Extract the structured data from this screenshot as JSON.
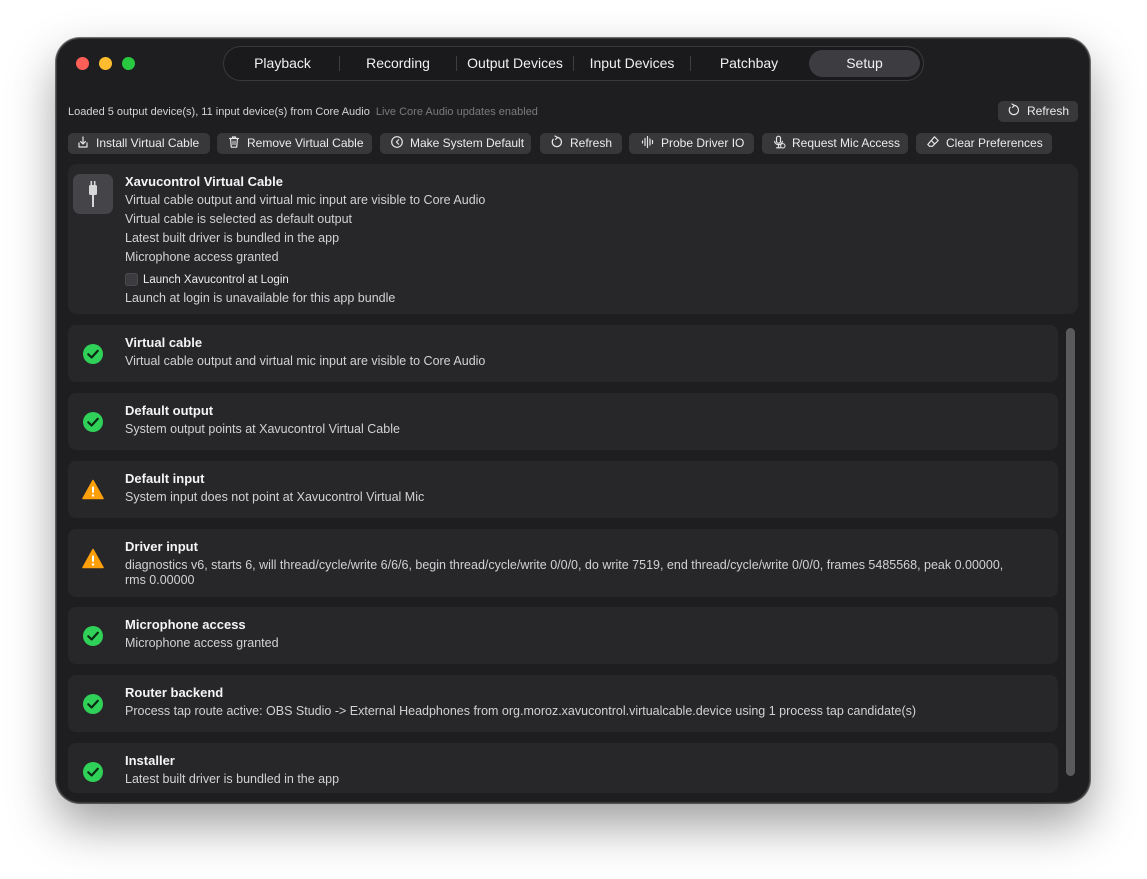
{
  "tabs": [
    {
      "label": "Playback"
    },
    {
      "label": "Recording"
    },
    {
      "label": "Output Devices"
    },
    {
      "label": "Input Devices"
    },
    {
      "label": "Patchbay"
    },
    {
      "label": "Setup",
      "active": true
    }
  ],
  "status": {
    "loaded": "Loaded 5 output device(s), 11 input device(s) from Core Audio",
    "live": "Live Core Audio updates enabled",
    "refresh_label": "Refresh"
  },
  "toolbar": {
    "install": "Install Virtual Cable",
    "remove": "Remove Virtual Cable",
    "make_default": "Make System Default",
    "refresh": "Refresh",
    "probe": "Probe Driver IO",
    "mic": "Request Mic Access",
    "clear": "Clear Preferences"
  },
  "info": {
    "title": "Xavucontrol Virtual Cable",
    "lines": [
      "Virtual cable output and virtual mic input are visible to Core Audio",
      "Virtual cable is selected as default output",
      "Latest built driver is bundled in the app",
      "Microphone access granted"
    ],
    "login_label": "Launch Xavucontrol at Login",
    "login_checked": false,
    "login_note": "Launch at login is unavailable for this app bundle"
  },
  "checks": [
    {
      "status": "ok",
      "title": "Virtual cable",
      "text": "Virtual cable output and virtual mic input are visible to Core Audio"
    },
    {
      "status": "ok",
      "title": "Default output",
      "text": "System output points at Xavucontrol Virtual Cable"
    },
    {
      "status": "warning",
      "title": "Default input",
      "text": "System input does not point at Xavucontrol Virtual Mic"
    },
    {
      "status": "warning",
      "title": "Driver input",
      "text": "diagnostics v6, starts 6, will thread/cycle/write 6/6/6, begin thread/cycle/write 0/0/0, do write 7519, end thread/cycle/write 0/0/0, frames 5485568, peak 0.00000, rms 0.00000"
    },
    {
      "status": "ok",
      "title": "Microphone access",
      "text": "Microphone access granted"
    },
    {
      "status": "ok",
      "title": "Router backend",
      "text": "Process tap route active: OBS Studio -> External Headphones from org.moroz.xavucontrol.virtualcable.device using 1 process tap candidate(s)"
    },
    {
      "status": "ok",
      "title": "Installer",
      "text": "Latest built driver is bundled in the app"
    }
  ],
  "colors": {
    "ok": "#30d158",
    "warning": "#ff9f0a",
    "window_bg": "#1e1e21",
    "card_bg": "#27272a"
  },
  "icons": {
    "install": "install-icon",
    "remove": "trash-icon",
    "make_default": "default-target-icon",
    "refresh": "refresh-icon",
    "probe": "waveform-icon",
    "mic": "microphone-icon",
    "clear": "eraser-icon",
    "app": "cable-plug-icon",
    "ok": "checkmark-circle-icon",
    "warning": "warning-triangle-icon"
  }
}
